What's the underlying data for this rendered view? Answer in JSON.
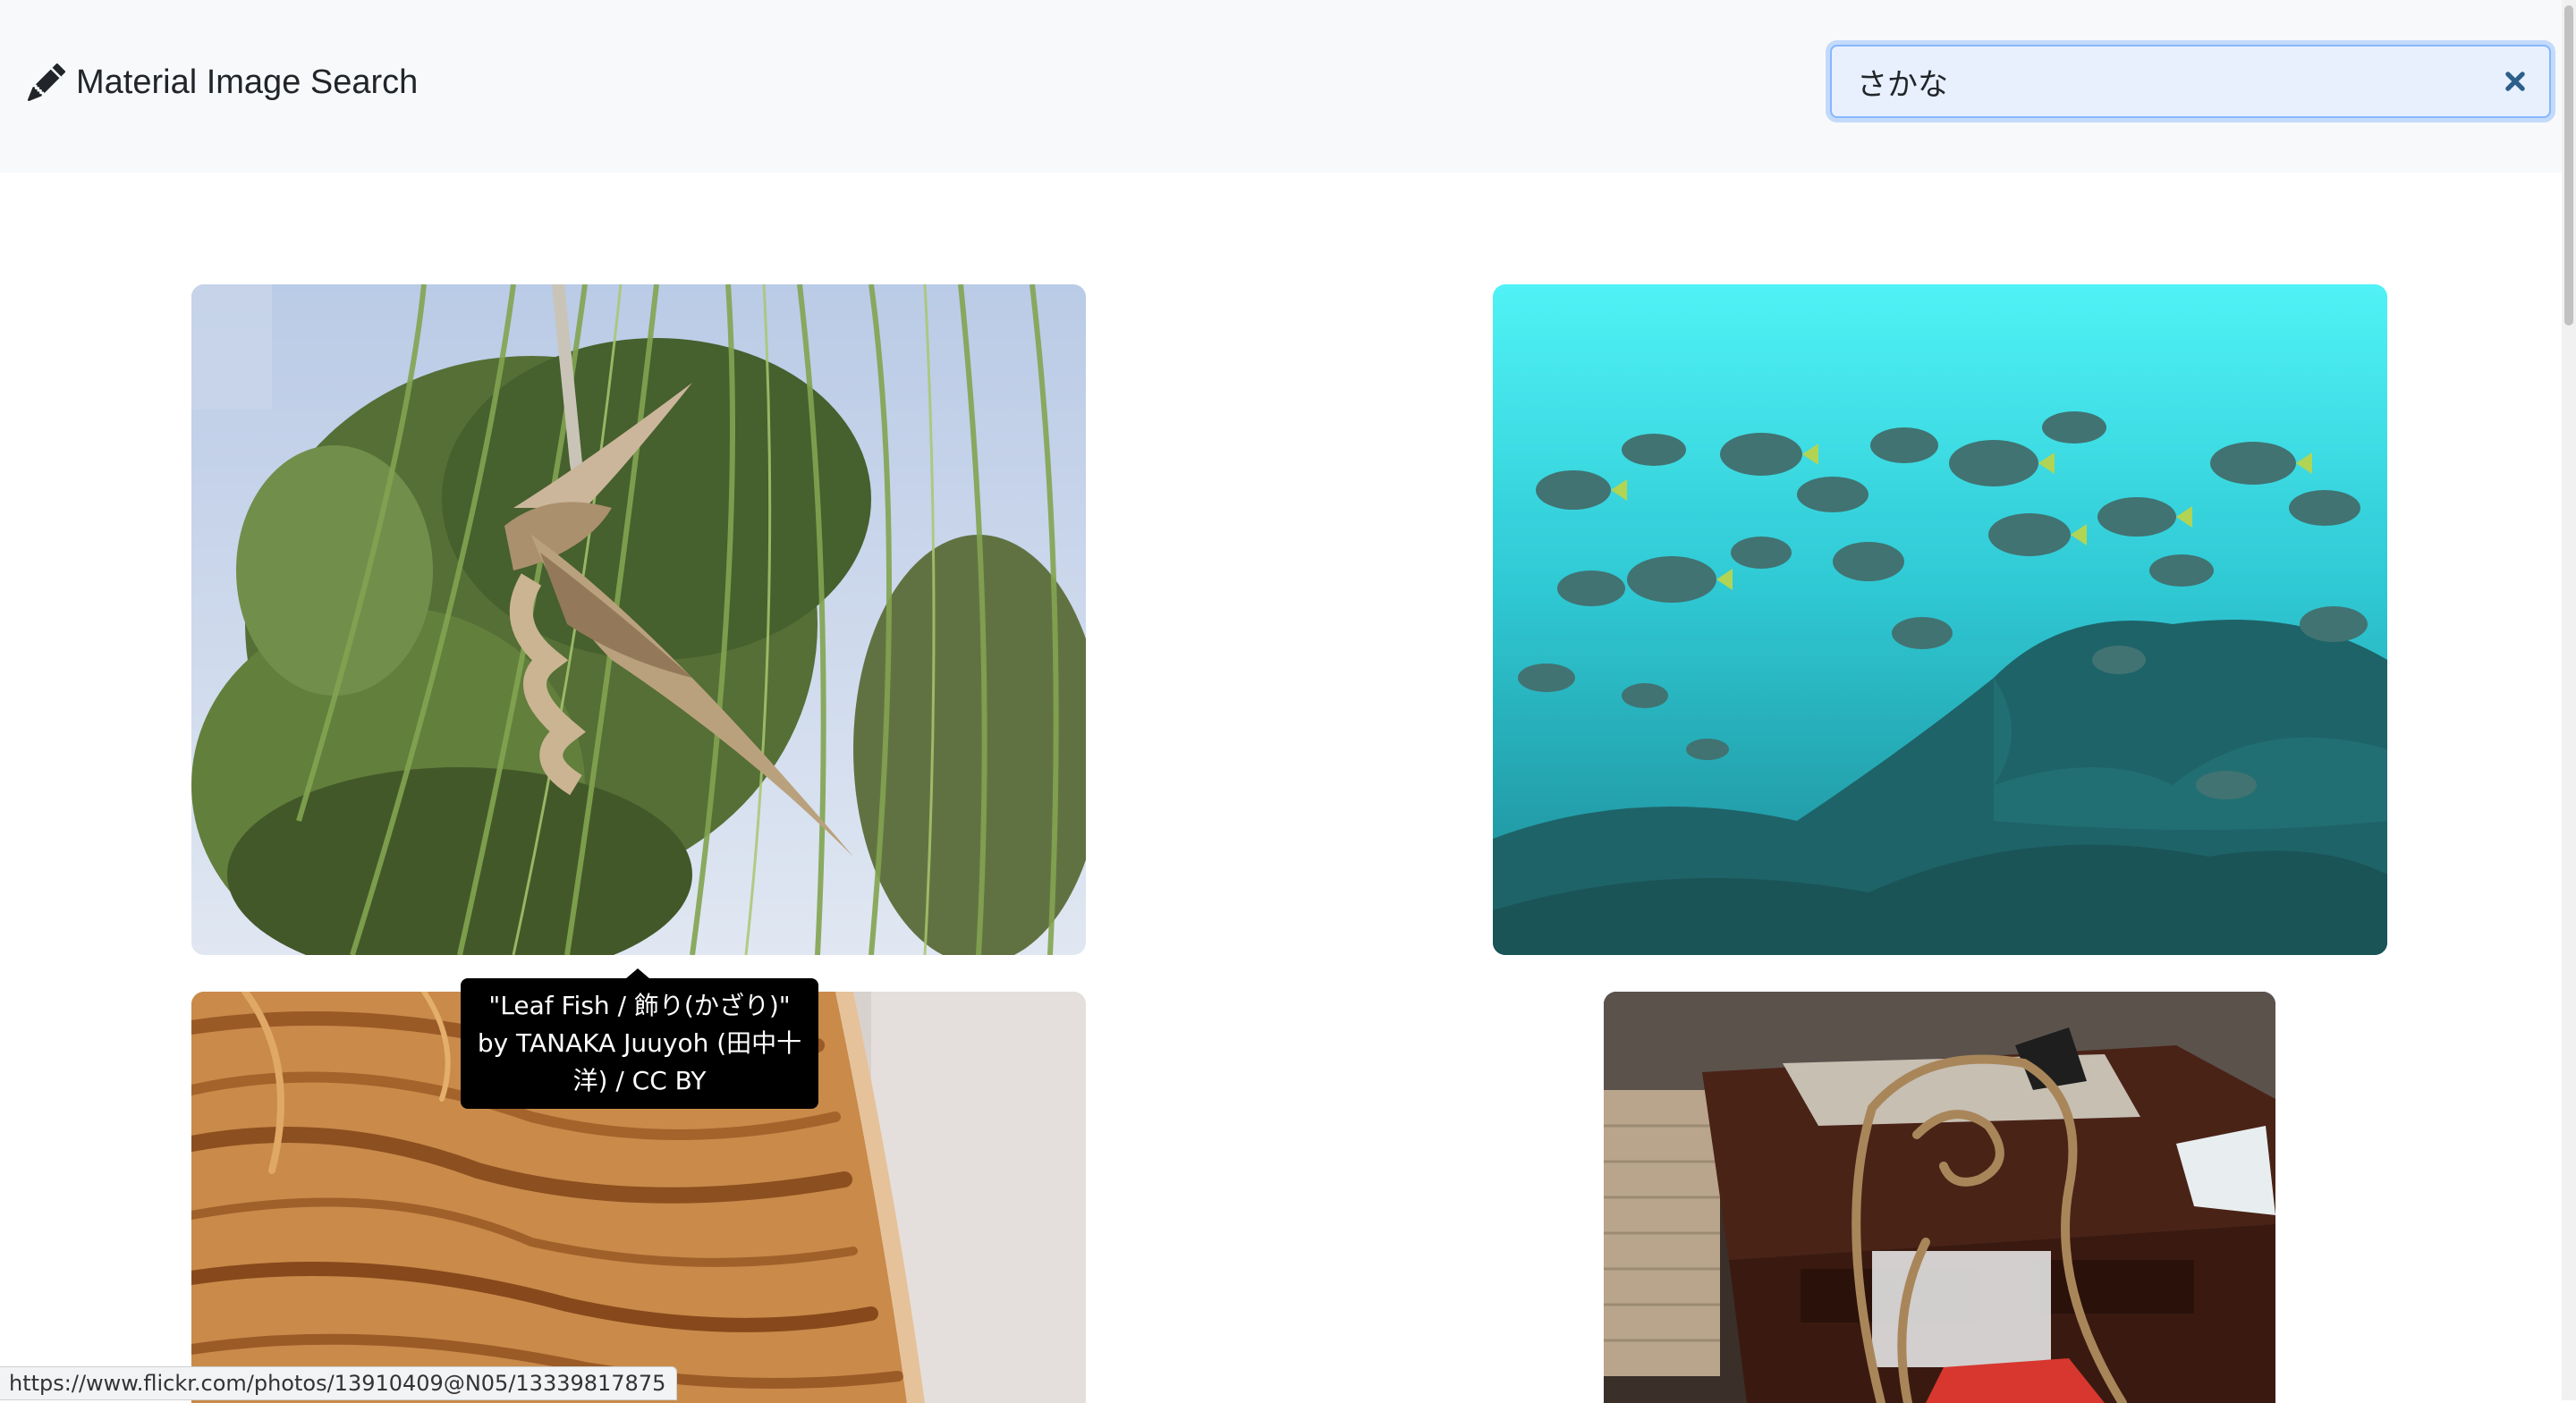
{
  "app": {
    "title": "Material Image Search",
    "brand_icon": "pencil-icon"
  },
  "search": {
    "value": "さかな",
    "clear_icon": "close-icon"
  },
  "results": [
    {
      "alt": "Leaf Fish",
      "tooltip": "\"Leaf Fish / 飾り(かざり)\" by TANAKA Juuyoh (田中十洋) / CC BY"
    },
    {
      "alt": "School of fish underwater"
    },
    {
      "alt": "Wood grain"
    },
    {
      "alt": "Desk with ornate metal chair"
    }
  ],
  "status_url": "https://www.flickr.com/photos/13910409@N05/13339817875",
  "colors": {
    "navbar_bg": "#f8f9fa",
    "focus_ring": "#86b7fe",
    "tooltip_bg": "#000000"
  }
}
